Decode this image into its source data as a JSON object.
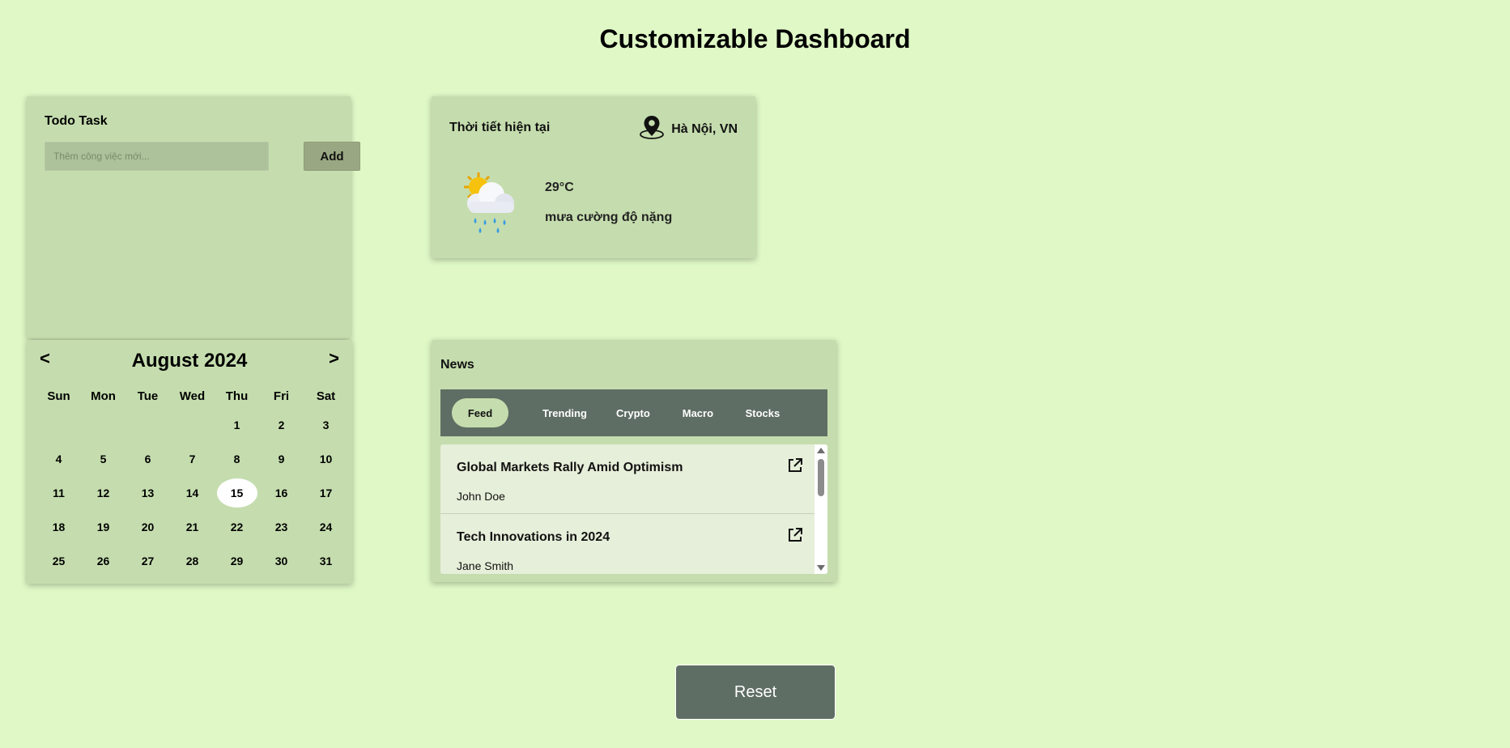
{
  "page": {
    "title": "Customizable Dashboard"
  },
  "todo": {
    "title": "Todo Task",
    "input_placeholder": "Thêm công việc mới...",
    "input_value": "",
    "add_label": "Add"
  },
  "weather": {
    "title": "Thời tiết hiện tại",
    "location": "Hà Nội, VN",
    "icon": "sun-cloud-rain-icon",
    "temperature": "29°C",
    "description": "mưa cường độ nặng"
  },
  "calendar": {
    "prev_label": "<",
    "next_label": ">",
    "month_label": "August 2024",
    "weekdays": [
      "Sun",
      "Mon",
      "Tue",
      "Wed",
      "Thu",
      "Fri",
      "Sat"
    ],
    "leading_blanks": 4,
    "days": [
      "1",
      "2",
      "3",
      "4",
      "5",
      "6",
      "7",
      "8",
      "9",
      "10",
      "11",
      "12",
      "13",
      "14",
      "15",
      "16",
      "17",
      "18",
      "19",
      "20",
      "21",
      "22",
      "23",
      "24",
      "25",
      "26",
      "27",
      "28",
      "29",
      "30",
      "31"
    ],
    "selected_day": "15"
  },
  "news": {
    "title": "News",
    "tabs": [
      {
        "label": "Feed",
        "active": true
      },
      {
        "label": "Trending",
        "active": false
      },
      {
        "label": "Crypto",
        "active": false
      },
      {
        "label": "Macro",
        "active": false
      },
      {
        "label": "Stocks",
        "active": false
      }
    ],
    "items": [
      {
        "title": "Global Markets Rally Amid Optimism",
        "author": "John Doe"
      },
      {
        "title": "Tech Innovations in 2024",
        "author": "Jane Smith"
      }
    ]
  },
  "reset": {
    "label": "Reset"
  },
  "colors": {
    "background": "#dff8c6",
    "card": "#c5ddae",
    "tab_bar": "#5f6e64",
    "button_dark": "#5f6e64"
  }
}
